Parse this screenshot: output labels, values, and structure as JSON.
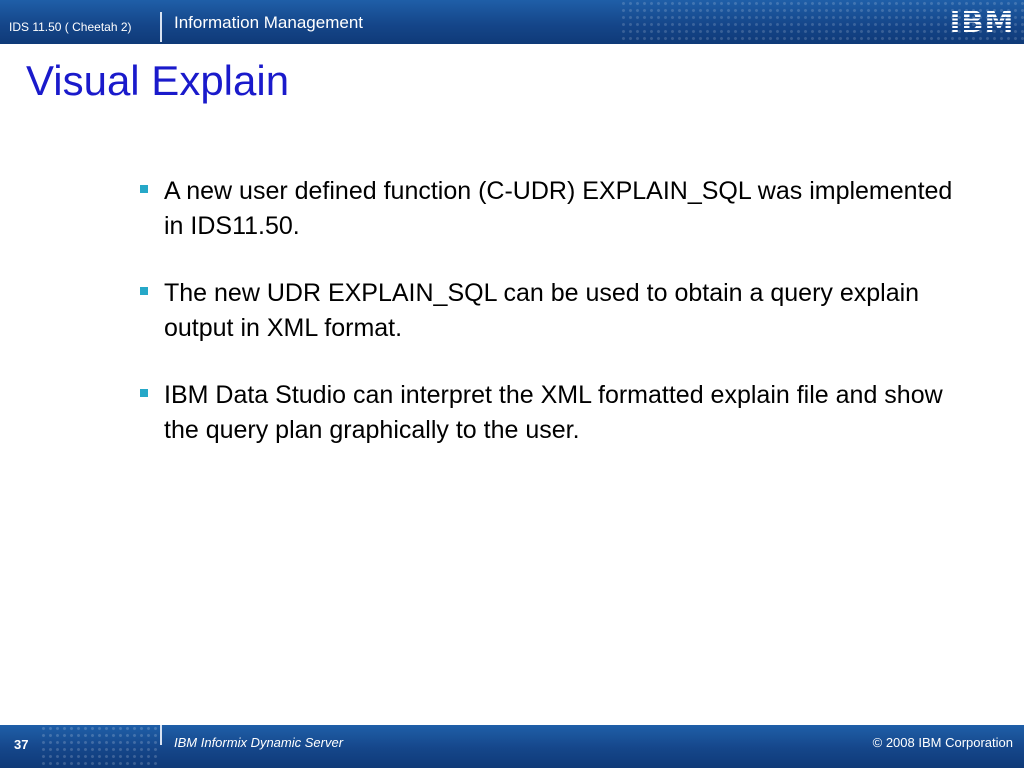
{
  "header": {
    "subtitle": "IDS 11.50 ( Cheetah 2)",
    "title": "Information Management",
    "logo_text": "IBM",
    "bar_color": "#15468a"
  },
  "slide": {
    "title": "Visual Explain",
    "title_color": "#1a1acb",
    "bullet_color": "#26a8c8",
    "bullets": [
      "A new user defined function (C-UDR) EXPLAIN_SQL was implemented in IDS11.50.",
      "The new UDR EXPLAIN_SQL can be used to obtain a query explain output in XML format.",
      "IBM Data Studio can interpret the XML formatted explain file and show the query plan graphically to the user."
    ]
  },
  "footer": {
    "page_number": "37",
    "product": "IBM Informix Dynamic Server",
    "copyright": "© 2008 IBM Corporation"
  }
}
